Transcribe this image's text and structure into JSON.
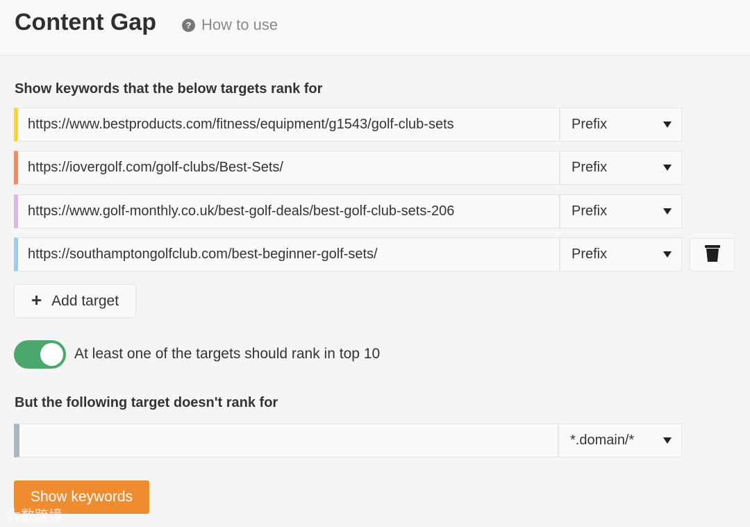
{
  "header": {
    "title": "Content Gap",
    "help_icon": "question-circle-icon",
    "help_label": "How to use"
  },
  "include_section": {
    "label": "Show keywords that the below targets rank for",
    "targets": [
      {
        "url": "https://www.bestproducts.com/fitness/equipment/g1543/golf-club-sets",
        "mode": "Prefix",
        "color": "#f5d547"
      },
      {
        "url": "https://iovergolf.com/golf-clubs/Best-Sets/",
        "mode": "Prefix",
        "color": "#ef8a6a"
      },
      {
        "url": "https://www.golf-monthly.co.uk/best-golf-deals/best-golf-club-sets-206",
        "mode": "Prefix",
        "color": "#d8b8e3"
      },
      {
        "url": "https://southamptongolfclub.com/best-beginner-golf-sets/",
        "mode": "Prefix",
        "color": "#9ecbee"
      }
    ],
    "delete_icon": "trash-icon",
    "add_target_label": "Add target"
  },
  "toggle": {
    "on": true,
    "label": "At least one of the targets should rank in top 10"
  },
  "exclude_section": {
    "label": "But the following target doesn't rank for",
    "target": {
      "url": "",
      "mode": "*.domain/*",
      "color": "#aab6c0"
    }
  },
  "submit": {
    "label": "Show keywords"
  },
  "watermark": {
    "text": "大数跨境"
  },
  "colors": {
    "accent": "#ef8c2f",
    "toggle_on": "#4aa86c"
  }
}
